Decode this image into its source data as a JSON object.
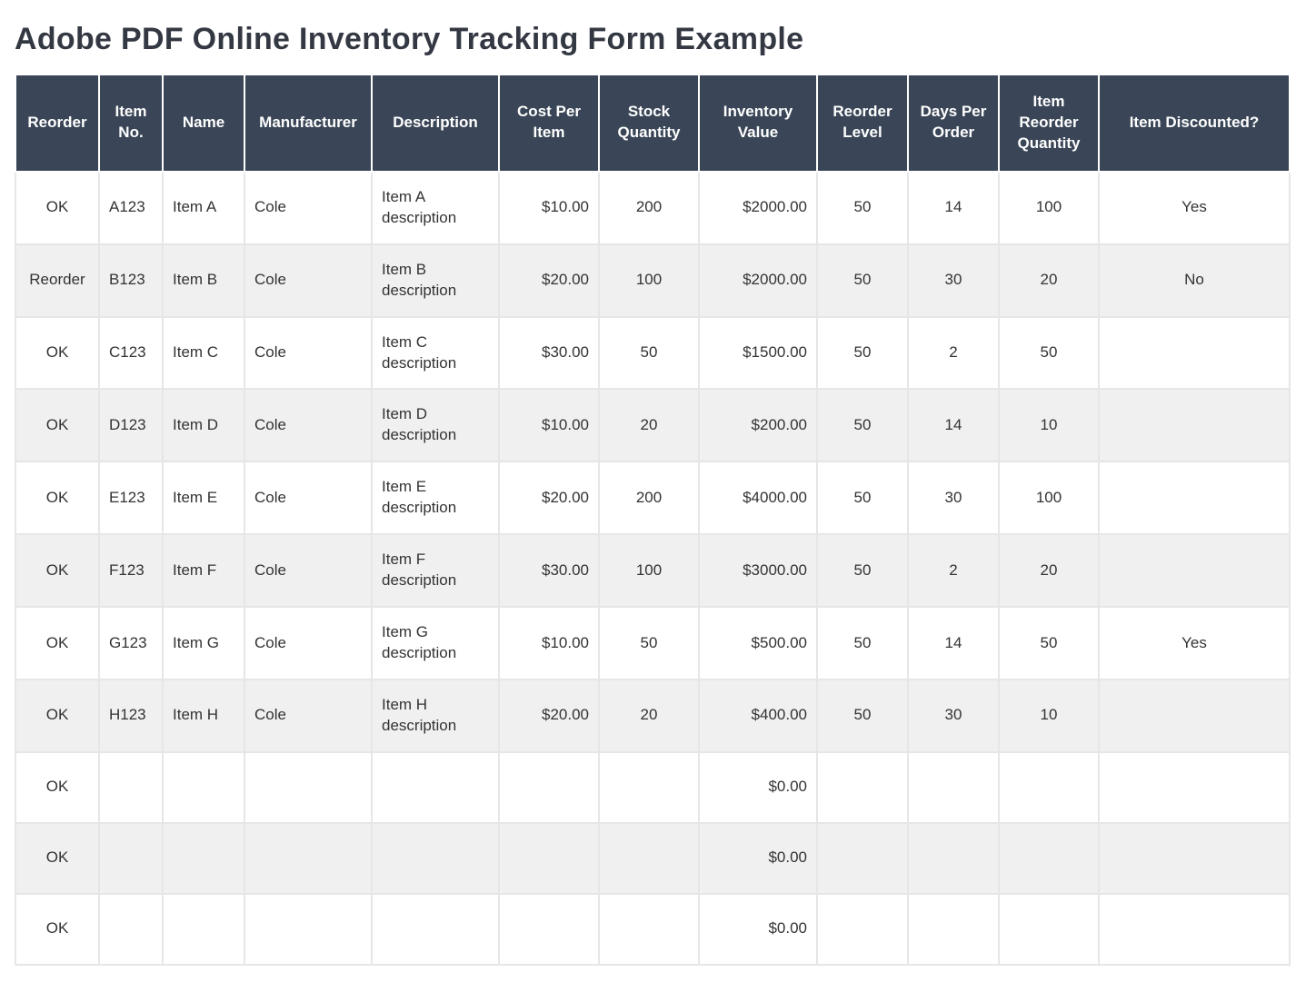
{
  "title": "Adobe PDF Online Inventory Tracking Form Example",
  "columns": [
    {
      "key": "reorder",
      "label": "Reorder",
      "align": "center"
    },
    {
      "key": "item_no",
      "label": "Item No.",
      "align": "left"
    },
    {
      "key": "name",
      "label": "Name",
      "align": "left"
    },
    {
      "key": "manufacturer",
      "label": "Manufacturer",
      "align": "left"
    },
    {
      "key": "description",
      "label": "Description",
      "align": "left"
    },
    {
      "key": "cost",
      "label": "Cost Per Item",
      "align": "right"
    },
    {
      "key": "stock",
      "label": "Stock Quantity",
      "align": "center"
    },
    {
      "key": "value",
      "label": "Inventory Value",
      "align": "right"
    },
    {
      "key": "reorder_lvl",
      "label": "Reorder Level",
      "align": "center"
    },
    {
      "key": "days",
      "label": "Days Per Order",
      "align": "center"
    },
    {
      "key": "reorder_qty",
      "label": "Item Reorder Quantity",
      "align": "center"
    },
    {
      "key": "discounted",
      "label": "Item Discounted?",
      "align": "center"
    }
  ],
  "rows": [
    {
      "reorder": "OK",
      "item_no": "A123",
      "name": "Item A",
      "manufacturer": "Cole",
      "description": "Item A description",
      "cost": "$10.00",
      "stock": "200",
      "value": "$2000.00",
      "reorder_lvl": "50",
      "days": "14",
      "reorder_qty": "100",
      "discounted": "Yes"
    },
    {
      "reorder": "Reorder",
      "item_no": "B123",
      "name": "Item B",
      "manufacturer": "Cole",
      "description": "Item B description",
      "cost": "$20.00",
      "stock": "100",
      "value": "$2000.00",
      "reorder_lvl": "50",
      "days": "30",
      "reorder_qty": "20",
      "discounted": "No"
    },
    {
      "reorder": "OK",
      "item_no": "C123",
      "name": "Item C",
      "manufacturer": "Cole",
      "description": "Item C description",
      "cost": "$30.00",
      "stock": "50",
      "value": "$1500.00",
      "reorder_lvl": "50",
      "days": "2",
      "reorder_qty": "50",
      "discounted": ""
    },
    {
      "reorder": "OK",
      "item_no": "D123",
      "name": "Item D",
      "manufacturer": "Cole",
      "description": "Item D description",
      "cost": "$10.00",
      "stock": "20",
      "value": "$200.00",
      "reorder_lvl": "50",
      "days": "14",
      "reorder_qty": "10",
      "discounted": ""
    },
    {
      "reorder": "OK",
      "item_no": "E123",
      "name": "Item E",
      "manufacturer": "Cole",
      "description": "Item E description",
      "cost": "$20.00",
      "stock": "200",
      "value": "$4000.00",
      "reorder_lvl": "50",
      "days": "30",
      "reorder_qty": "100",
      "discounted": ""
    },
    {
      "reorder": "OK",
      "item_no": "F123",
      "name": "Item F",
      "manufacturer": "Cole",
      "description": "Item F description",
      "cost": "$30.00",
      "stock": "100",
      "value": "$3000.00",
      "reorder_lvl": "50",
      "days": "2",
      "reorder_qty": "20",
      "discounted": ""
    },
    {
      "reorder": "OK",
      "item_no": "G123",
      "name": "Item G",
      "manufacturer": "Cole",
      "description": "Item G description",
      "cost": "$10.00",
      "stock": "50",
      "value": "$500.00",
      "reorder_lvl": "50",
      "days": "14",
      "reorder_qty": "50",
      "discounted": "Yes"
    },
    {
      "reorder": "OK",
      "item_no": "H123",
      "name": "Item H",
      "manufacturer": "Cole",
      "description": "Item H description",
      "cost": "$20.00",
      "stock": "20",
      "value": "$400.00",
      "reorder_lvl": "50",
      "days": "30",
      "reorder_qty": "10",
      "discounted": ""
    },
    {
      "reorder": "OK",
      "item_no": "",
      "name": "",
      "manufacturer": "",
      "description": "",
      "cost": "",
      "stock": "",
      "value": "$0.00",
      "reorder_lvl": "",
      "days": "",
      "reorder_qty": "",
      "discounted": ""
    },
    {
      "reorder": "OK",
      "item_no": "",
      "name": "",
      "manufacturer": "",
      "description": "",
      "cost": "",
      "stock": "",
      "value": "$0.00",
      "reorder_lvl": "",
      "days": "",
      "reorder_qty": "",
      "discounted": ""
    },
    {
      "reorder": "OK",
      "item_no": "",
      "name": "",
      "manufacturer": "",
      "description": "",
      "cost": "",
      "stock": "",
      "value": "$0.00",
      "reorder_lvl": "",
      "days": "",
      "reorder_qty": "",
      "discounted": ""
    }
  ]
}
